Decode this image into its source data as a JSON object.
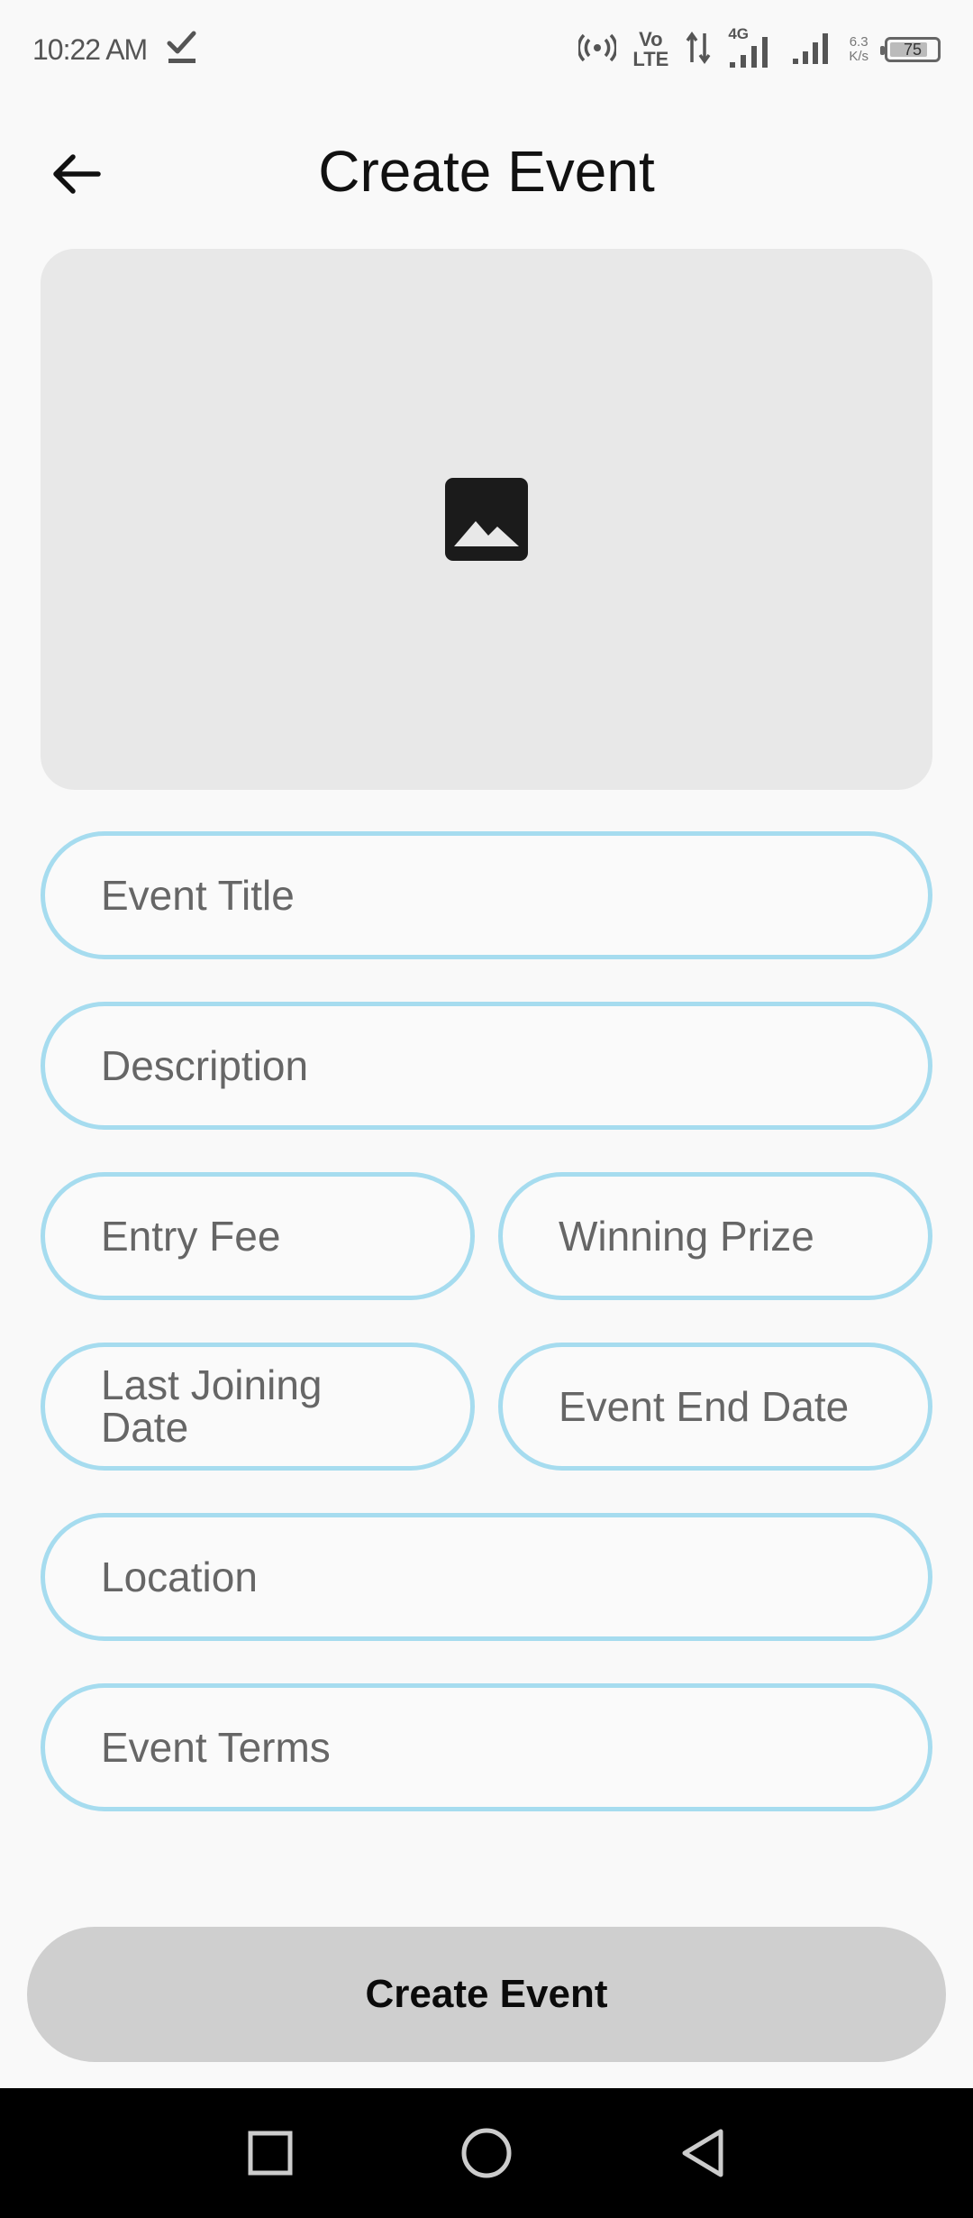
{
  "status_bar": {
    "time": "10:22 AM",
    "network_label_vo": "Vo",
    "network_label_lte": "LTE",
    "network_4g": "4G",
    "speed_value": "6.3",
    "speed_unit": "K/s",
    "battery_level": "75",
    "icons": [
      "check-icon",
      "hotspot-icon",
      "data-arrows-icon",
      "signal-icon",
      "signal-icon-2"
    ]
  },
  "app_bar": {
    "title": "Create Event",
    "back_icon": "arrow-left-icon"
  },
  "image_picker": {
    "icon": "image-icon",
    "background": "#e8e8e8"
  },
  "form": {
    "event_title_placeholder": "Event Title",
    "description_placeholder": "Description",
    "entry_fee_placeholder": "Entry Fee",
    "winning_prize_placeholder": "Winning Prize",
    "last_joining_date_placeholder": "Last Joining Date",
    "event_end_date_placeholder": "Event End Date",
    "location_placeholder": "Location",
    "event_terms_placeholder": "Event Terms",
    "border_color": "#a6dcef"
  },
  "actions": {
    "create_label": "Create Event",
    "button_color": "#cfcfcf"
  },
  "nav_bar": {
    "icons": [
      "recents-square-icon",
      "home-circle-icon",
      "back-triangle-icon"
    ]
  }
}
